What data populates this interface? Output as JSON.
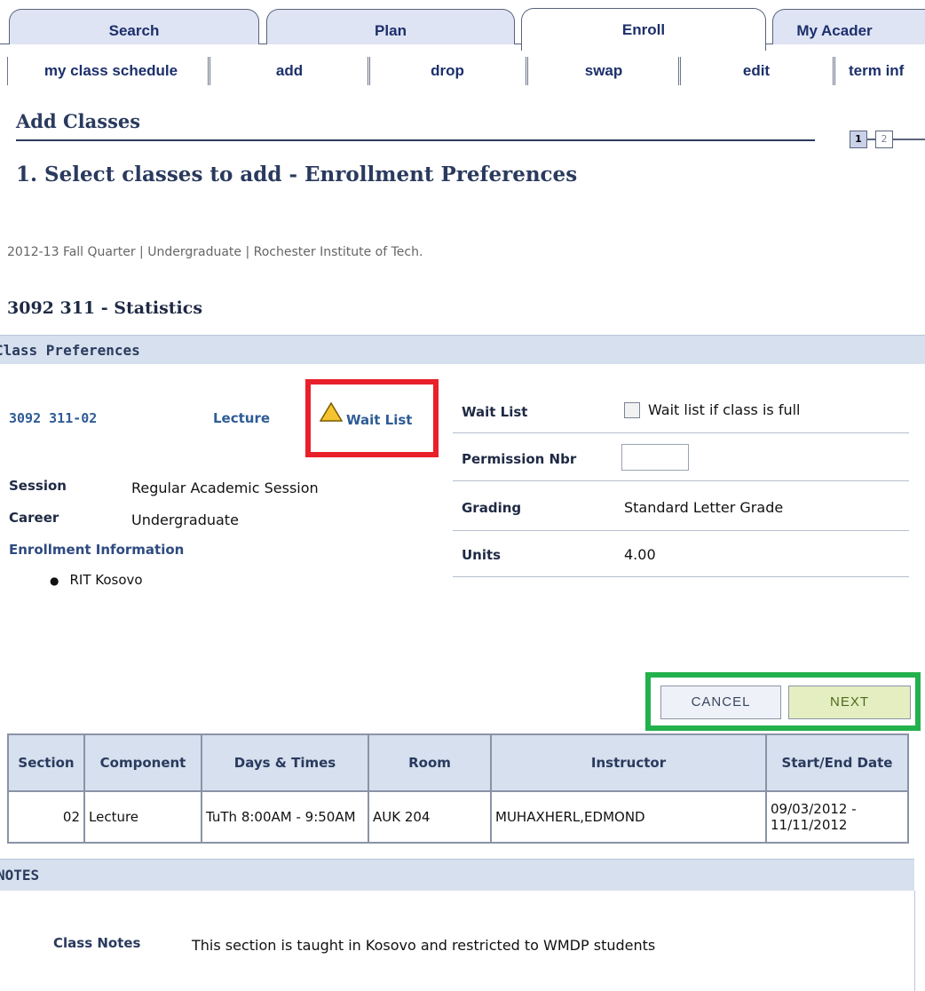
{
  "tabs": [
    {
      "label": "Search",
      "active": false
    },
    {
      "label": "Plan",
      "active": false
    },
    {
      "label": "Enroll",
      "active": true
    },
    {
      "label": "My Acader",
      "active": false
    }
  ],
  "subtabs": [
    "my class schedule",
    "add",
    "drop",
    "swap",
    "edit",
    "term inf"
  ],
  "page_title": "Add Classes",
  "steps": [
    "1",
    "2"
  ],
  "step_heading": "1.  Select classes to add - Enrollment Preferences",
  "term_info": "2012-13 Fall Quarter | Undergraduate | Rochester Institute of Tech.",
  "course_title": "3092  311 - Statistics",
  "class_prefs": {
    "header": "Class Preferences",
    "section_code": "3092  311-02",
    "component": "Lecture",
    "wait_list_link": "Wait List",
    "session_label": "Session",
    "session_value": "Regular Academic Session",
    "career_label": "Career",
    "career_value": "Undergraduate",
    "enroll_info_label": "Enrollment Information",
    "enroll_info_items": [
      "RIT Kosovo"
    ],
    "wait_list_label": "Wait List",
    "wait_list_checkbox_text": "Wait list if class is full",
    "wait_list_checked": false,
    "permission_label": "Permission Nbr",
    "permission_value": "",
    "grading_label": "Grading",
    "grading_value": "Standard Letter Grade",
    "units_label": "Units",
    "units_value": "4.00"
  },
  "buttons": {
    "cancel": "CANCEL",
    "next": "NEXT"
  },
  "table": {
    "headers": [
      "Section",
      "Component",
      "Days & Times",
      "Room",
      "Instructor",
      "Start/End Date"
    ],
    "rows": [
      [
        "02",
        "Lecture",
        "TuTh 8:00AM - 9:50AM",
        "AUK 204",
        "MUHAXHERL,EDMOND",
        "09/03/2012 - 11/11/2012"
      ]
    ]
  },
  "notes": {
    "header": "NOTES",
    "class_notes_label": "Class Notes",
    "class_notes_text": "This section is taught in Kosovo and restricted to WMDP students"
  },
  "colors": {
    "highlight_red": "#e8202a",
    "highlight_green": "#22b14c",
    "section_bar": "#d6e0ee",
    "next_button": "#e4eec0"
  }
}
